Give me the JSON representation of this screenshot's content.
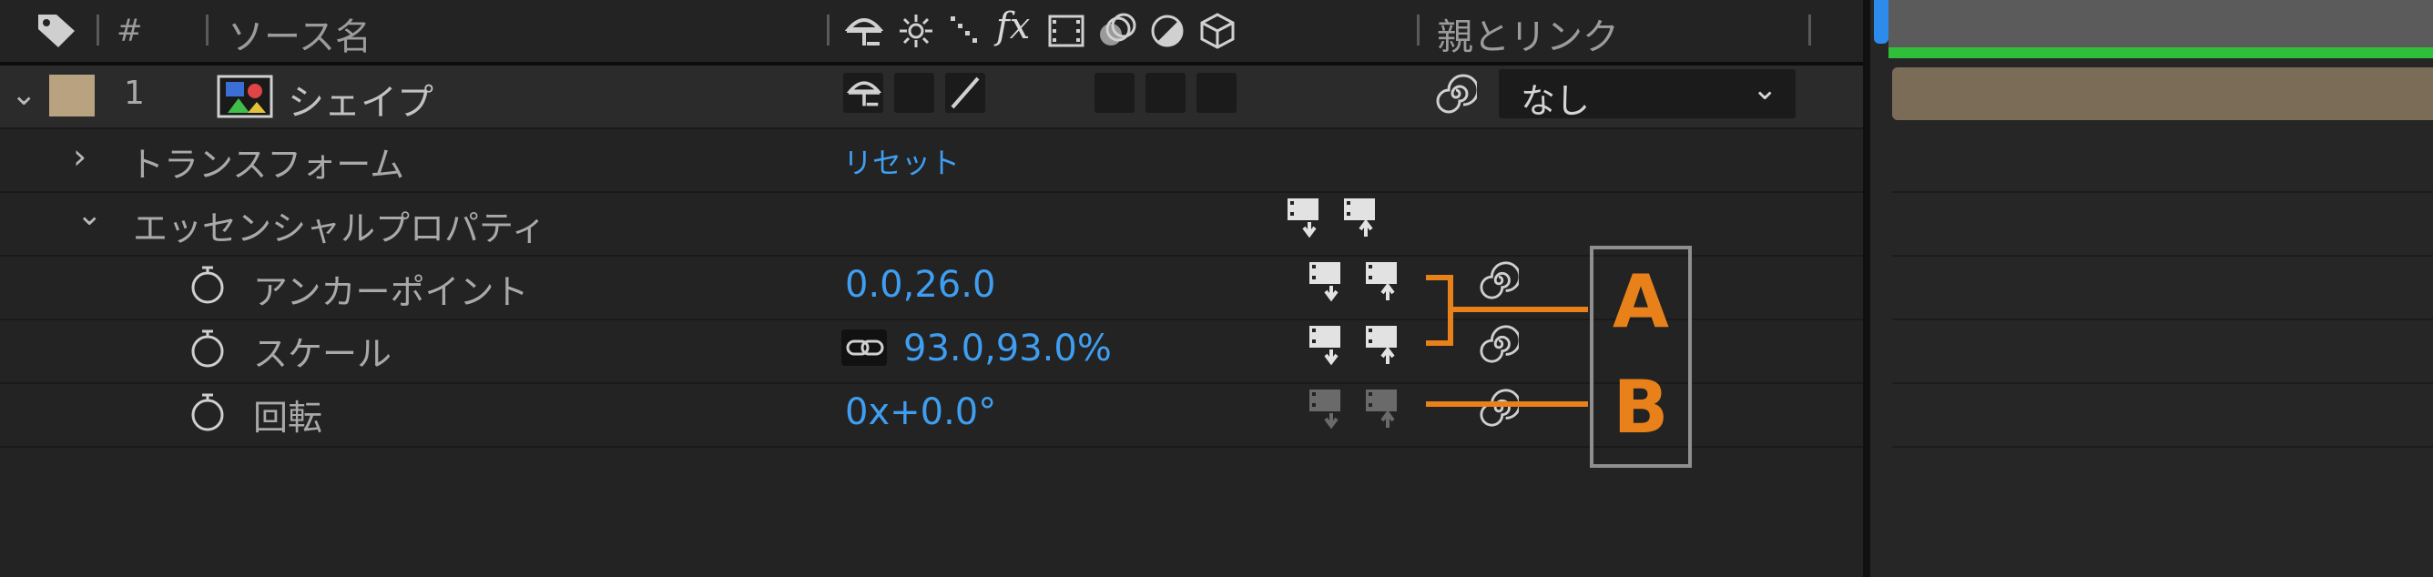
{
  "header": {
    "number_col": "#",
    "source_name_col": "ソース名",
    "fx_label": "fx",
    "parent_link_col": "親とリンク"
  },
  "layer": {
    "number": "1",
    "name": "シェイプ",
    "parent_value": "なし",
    "label_color": "#b8a27f"
  },
  "rows": {
    "transform_label": "トランスフォーム",
    "transform_reset": "リセット",
    "essential_label": "エッセンシャルプロパティ",
    "anchor_label": "アンカーポイント",
    "anchor_value": "0.0,26.0",
    "scale_label": "スケール",
    "scale_value": "93.0,93.0%",
    "rotation_label": "回転",
    "rotation_value": "0x+0.0°"
  },
  "annotation": {
    "label_a": "A",
    "label_b": "B",
    "color": "#e8811a"
  },
  "colors": {
    "accent_blue": "#3f9ef0",
    "work_area_green": "#2fbf3a",
    "layer_bar": "#7b6c58"
  }
}
